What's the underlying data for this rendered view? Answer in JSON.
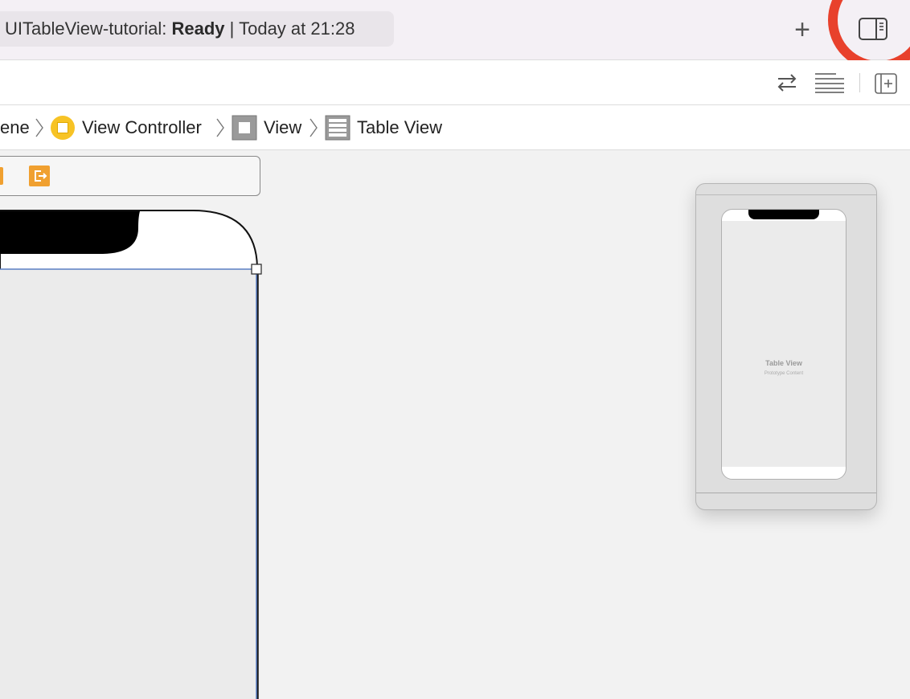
{
  "titlebar": {
    "status_project": "UITableView-tutorial:",
    "status_state": "Ready",
    "status_separator": "|",
    "status_time": "Today at 21:28",
    "plus_label": "+"
  },
  "icons": {
    "add": "plus-icon",
    "inspector_toggle": "sidebar-right-icon",
    "swap": "arrows-swap-icon",
    "adjust": "lines-align-icon",
    "add_editor": "add-editor-icon",
    "exit": "exit-icon",
    "view_controller": "view-controller-icon",
    "view": "view-icon",
    "table_view": "table-view-icon"
  },
  "breadcrumb": {
    "items": [
      {
        "label": "ene"
      },
      {
        "label": "View Controller"
      },
      {
        "label": "View"
      },
      {
        "label": "Table View"
      }
    ]
  },
  "minimap": {
    "title": "Table View",
    "subtitle": "Prototype Content"
  },
  "colors": {
    "annotation_circle": "#e8412c",
    "view_controller_icon": "#f7c325",
    "exit_icon": "#f0a030",
    "selection": "#5b7fc4"
  }
}
